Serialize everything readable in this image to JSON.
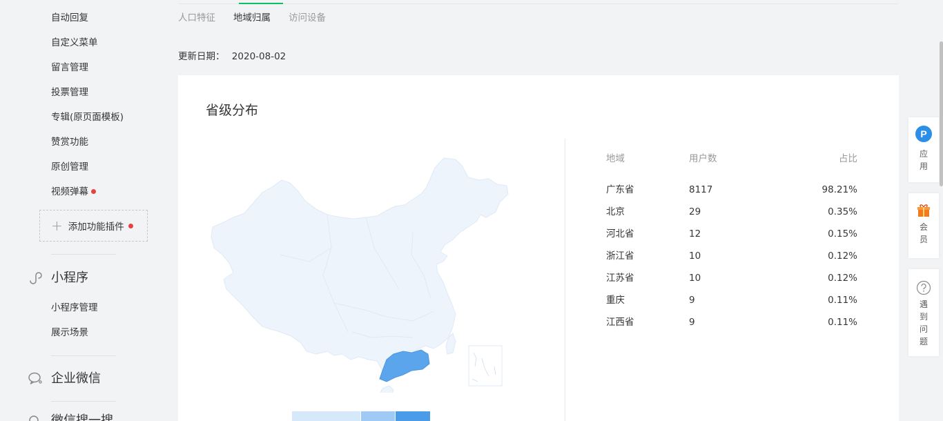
{
  "sidebar": {
    "items": [
      {
        "label": "自动回复"
      },
      {
        "label": "自定义菜单"
      },
      {
        "label": "留言管理"
      },
      {
        "label": "投票管理"
      },
      {
        "label": "专辑(原页面模板)"
      },
      {
        "label": "赞赏功能"
      },
      {
        "label": "原创管理"
      },
      {
        "label": "视频弹幕"
      }
    ],
    "add_plugin_label": "添加功能插件",
    "miniprogram": {
      "title": "小程序",
      "items": [
        {
          "label": "小程序管理"
        },
        {
          "label": "展示场景"
        }
      ]
    },
    "wecom": {
      "title": "企业微信"
    },
    "next_section_title": "微信搜一搜"
  },
  "tabs": [
    {
      "label": "人口特征",
      "active": false
    },
    {
      "label": "地域归属",
      "active": true
    },
    {
      "label": "访问设备",
      "active": false
    }
  ],
  "update": {
    "label": "更新日期：",
    "date": "2020-08-02"
  },
  "card": {
    "title": "省级分布",
    "table": {
      "headers": {
        "region": "地域",
        "users": "用户数",
        "ratio": "占比"
      },
      "rows": [
        {
          "region": "广东省",
          "users": "8117",
          "ratio": "98.21%"
        },
        {
          "region": "北京",
          "users": "29",
          "ratio": "0.35%"
        },
        {
          "region": "河北省",
          "users": "12",
          "ratio": "0.15%"
        },
        {
          "region": "浙江省",
          "users": "10",
          "ratio": "0.12%"
        },
        {
          "region": "江苏省",
          "users": "10",
          "ratio": "0.12%"
        },
        {
          "region": "重庆",
          "users": "9",
          "ratio": "0.11%"
        },
        {
          "region": "江西省",
          "users": "9",
          "ratio": "0.11%"
        }
      ]
    },
    "legend_colors": [
      "#d6e9fb",
      "#9ecaf5",
      "#4a9be8"
    ],
    "map_colors": {
      "base": "#edf4fc",
      "highlight": "#5aa5ec",
      "border": "#dfe9f5"
    }
  },
  "float_panel": {
    "apps": {
      "icon_letter": "P",
      "label": "应用"
    },
    "member": {
      "label": "会员"
    },
    "help": {
      "label": "遇到问题"
    }
  },
  "colors": {
    "accent": "#07c160",
    "dot": "#e64340",
    "app_icon": "#2b8fe7"
  }
}
